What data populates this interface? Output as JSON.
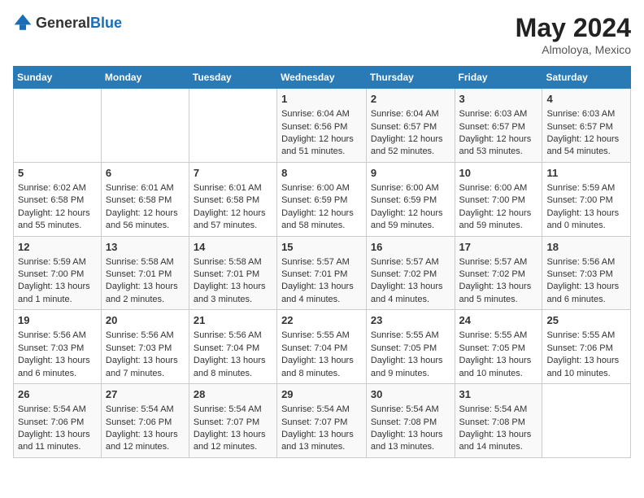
{
  "header": {
    "logo_general": "General",
    "logo_blue": "Blue",
    "month": "May 2024",
    "location": "Almoloya, Mexico"
  },
  "days_of_week": [
    "Sunday",
    "Monday",
    "Tuesday",
    "Wednesday",
    "Thursday",
    "Friday",
    "Saturday"
  ],
  "weeks": [
    {
      "days": [
        {
          "num": "",
          "content": ""
        },
        {
          "num": "",
          "content": ""
        },
        {
          "num": "",
          "content": ""
        },
        {
          "num": "1",
          "content": "Sunrise: 6:04 AM\nSunset: 6:56 PM\nDaylight: 12 hours\nand 51 minutes."
        },
        {
          "num": "2",
          "content": "Sunrise: 6:04 AM\nSunset: 6:57 PM\nDaylight: 12 hours\nand 52 minutes."
        },
        {
          "num": "3",
          "content": "Sunrise: 6:03 AM\nSunset: 6:57 PM\nDaylight: 12 hours\nand 53 minutes."
        },
        {
          "num": "4",
          "content": "Sunrise: 6:03 AM\nSunset: 6:57 PM\nDaylight: 12 hours\nand 54 minutes."
        }
      ]
    },
    {
      "days": [
        {
          "num": "5",
          "content": "Sunrise: 6:02 AM\nSunset: 6:58 PM\nDaylight: 12 hours\nand 55 minutes."
        },
        {
          "num": "6",
          "content": "Sunrise: 6:01 AM\nSunset: 6:58 PM\nDaylight: 12 hours\nand 56 minutes."
        },
        {
          "num": "7",
          "content": "Sunrise: 6:01 AM\nSunset: 6:58 PM\nDaylight: 12 hours\nand 57 minutes."
        },
        {
          "num": "8",
          "content": "Sunrise: 6:00 AM\nSunset: 6:59 PM\nDaylight: 12 hours\nand 58 minutes."
        },
        {
          "num": "9",
          "content": "Sunrise: 6:00 AM\nSunset: 6:59 PM\nDaylight: 12 hours\nand 59 minutes."
        },
        {
          "num": "10",
          "content": "Sunrise: 6:00 AM\nSunset: 7:00 PM\nDaylight: 12 hours\nand 59 minutes."
        },
        {
          "num": "11",
          "content": "Sunrise: 5:59 AM\nSunset: 7:00 PM\nDaylight: 13 hours\nand 0 minutes."
        }
      ]
    },
    {
      "days": [
        {
          "num": "12",
          "content": "Sunrise: 5:59 AM\nSunset: 7:00 PM\nDaylight: 13 hours\nand 1 minute."
        },
        {
          "num": "13",
          "content": "Sunrise: 5:58 AM\nSunset: 7:01 PM\nDaylight: 13 hours\nand 2 minutes."
        },
        {
          "num": "14",
          "content": "Sunrise: 5:58 AM\nSunset: 7:01 PM\nDaylight: 13 hours\nand 3 minutes."
        },
        {
          "num": "15",
          "content": "Sunrise: 5:57 AM\nSunset: 7:01 PM\nDaylight: 13 hours\nand 4 minutes."
        },
        {
          "num": "16",
          "content": "Sunrise: 5:57 AM\nSunset: 7:02 PM\nDaylight: 13 hours\nand 4 minutes."
        },
        {
          "num": "17",
          "content": "Sunrise: 5:57 AM\nSunset: 7:02 PM\nDaylight: 13 hours\nand 5 minutes."
        },
        {
          "num": "18",
          "content": "Sunrise: 5:56 AM\nSunset: 7:03 PM\nDaylight: 13 hours\nand 6 minutes."
        }
      ]
    },
    {
      "days": [
        {
          "num": "19",
          "content": "Sunrise: 5:56 AM\nSunset: 7:03 PM\nDaylight: 13 hours\nand 6 minutes."
        },
        {
          "num": "20",
          "content": "Sunrise: 5:56 AM\nSunset: 7:03 PM\nDaylight: 13 hours\nand 7 minutes."
        },
        {
          "num": "21",
          "content": "Sunrise: 5:56 AM\nSunset: 7:04 PM\nDaylight: 13 hours\nand 8 minutes."
        },
        {
          "num": "22",
          "content": "Sunrise: 5:55 AM\nSunset: 7:04 PM\nDaylight: 13 hours\nand 8 minutes."
        },
        {
          "num": "23",
          "content": "Sunrise: 5:55 AM\nSunset: 7:05 PM\nDaylight: 13 hours\nand 9 minutes."
        },
        {
          "num": "24",
          "content": "Sunrise: 5:55 AM\nSunset: 7:05 PM\nDaylight: 13 hours\nand 10 minutes."
        },
        {
          "num": "25",
          "content": "Sunrise: 5:55 AM\nSunset: 7:06 PM\nDaylight: 13 hours\nand 10 minutes."
        }
      ]
    },
    {
      "days": [
        {
          "num": "26",
          "content": "Sunrise: 5:54 AM\nSunset: 7:06 PM\nDaylight: 13 hours\nand 11 minutes."
        },
        {
          "num": "27",
          "content": "Sunrise: 5:54 AM\nSunset: 7:06 PM\nDaylight: 13 hours\nand 12 minutes."
        },
        {
          "num": "28",
          "content": "Sunrise: 5:54 AM\nSunset: 7:07 PM\nDaylight: 13 hours\nand 12 minutes."
        },
        {
          "num": "29",
          "content": "Sunrise: 5:54 AM\nSunset: 7:07 PM\nDaylight: 13 hours\nand 13 minutes."
        },
        {
          "num": "30",
          "content": "Sunrise: 5:54 AM\nSunset: 7:08 PM\nDaylight: 13 hours\nand 13 minutes."
        },
        {
          "num": "31",
          "content": "Sunrise: 5:54 AM\nSunset: 7:08 PM\nDaylight: 13 hours\nand 14 minutes."
        },
        {
          "num": "",
          "content": ""
        }
      ]
    }
  ]
}
